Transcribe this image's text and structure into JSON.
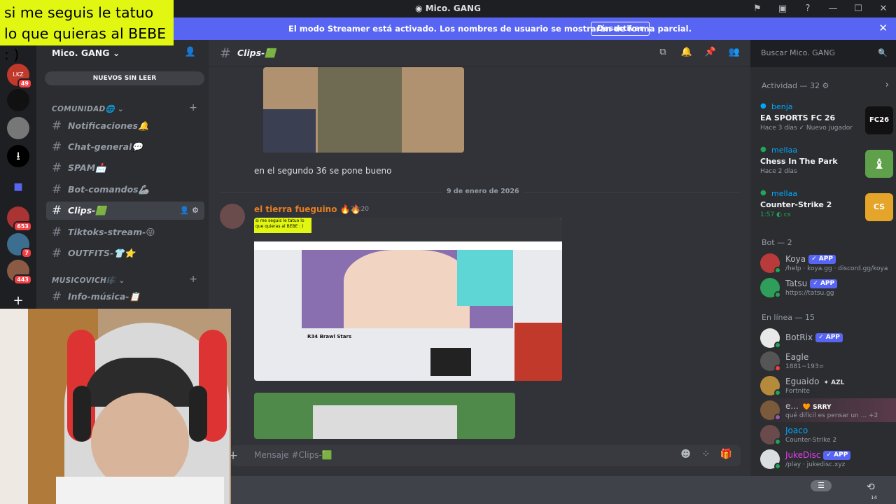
{
  "window": {
    "title": "Mico. GANG"
  },
  "overlay": {
    "text": "si me seguis le tatuo lo que quieras al BEBE : )"
  },
  "banner": {
    "text": "El modo Streamer está activado. Los nombres de usuario se mostrarán de forma parcial.",
    "button": "Desactivar"
  },
  "guilds": [
    {
      "label": "LKZ",
      "badge": "49"
    },
    {
      "label": "",
      "badge": ""
    },
    {
      "label": "",
      "badge": ""
    },
    {
      "label": "",
      "badge": ""
    },
    {
      "label": "",
      "badge": ""
    },
    {
      "label": "",
      "badge": "653"
    },
    {
      "label": "",
      "badge": "7"
    },
    {
      "label": "",
      "badge": "443"
    }
  ],
  "server": {
    "name": "Mico. GANG ⌄",
    "new_unread": "NUEVOS SIN LEER"
  },
  "categories": [
    {
      "name": "COMUNIDAD🌐 ⌄"
    },
    {
      "name": "MUSICOVICH🎼 ⌄"
    }
  ],
  "channels": [
    {
      "name": "Notificaciones🔔"
    },
    {
      "name": "Chat-general💬"
    },
    {
      "name": "SPAM📩"
    },
    {
      "name": "Bot-comandos🦾"
    },
    {
      "name": "Clips-🟩"
    },
    {
      "name": "Tiktoks-stream-😜"
    },
    {
      "name": "OUTFITS-👕⭐"
    },
    {
      "name": "Info-música-📋"
    }
  ],
  "channel_header": {
    "name": "Clips-🟩"
  },
  "search": {
    "placeholder": "Buscar Mico. GANG"
  },
  "messages": [
    {
      "text": "en el segundo 36 se pone bueno"
    },
    {
      "author": "el tierra fueguino 🔥🔥",
      "time": "20:20"
    }
  ],
  "date_divider": "9 de enero de 2026",
  "embed": {
    "overlay_text": "si me seguis le tatuo lo que quieras al BEBE : )",
    "page_title": "R34 Brawl Stars"
  },
  "composer": {
    "placeholder": "Mensaje #Clips-🟩"
  },
  "activity": {
    "header": "Actividad — 32 ⚙",
    "items": [
      {
        "user": "benja",
        "game": "EA SPORTS FC 26",
        "meta": "Hace 3 días  ✓ Nuevo jugador",
        "art": "FC26"
      },
      {
        "user": "mellaa",
        "game": "Chess In The Park",
        "meta": "Hace 2 días",
        "art": "♝"
      },
      {
        "user": "mellaa",
        "game": "Counter-Strike 2",
        "meta": "1:57  ◐ cs",
        "art": "CS"
      }
    ]
  },
  "bots": {
    "header": "Bot — 2",
    "items": [
      {
        "name": "Koya",
        "tag": "✓ APP",
        "status": "/help · koya.gg · discord.gg/koya"
      },
      {
        "name": "Tatsu",
        "tag": "✓ APP",
        "status": "https://tatsu.gg"
      }
    ]
  },
  "online": {
    "header": "En línea — 15",
    "items": [
      {
        "name": "BotRix",
        "tag": "✓ APP",
        "status": ""
      },
      {
        "name": "Eagle",
        "tag": "",
        "status": "1881~193="
      },
      {
        "name": "Eguaido",
        "tag": "✦ AZL",
        "status": "Fortnite"
      },
      {
        "name": "e...",
        "tag": "🧡 SRRY",
        "status": "qué difícil es pensar un ... +2"
      },
      {
        "name": "Joaco",
        "tag": "",
        "status": "Counter-Strike 2"
      },
      {
        "name": "JukeDisc",
        "tag": "✓ APP",
        "status": "/play · jukedisc.xyz"
      }
    ]
  },
  "bottom": {
    "notif_count": "14"
  },
  "colors": {
    "accent": "#5865f2",
    "overlay": "#e1f711",
    "bg_main": "#313338",
    "bg_sidebar": "#2b2d31",
    "bg_dark": "#1e1f22"
  }
}
